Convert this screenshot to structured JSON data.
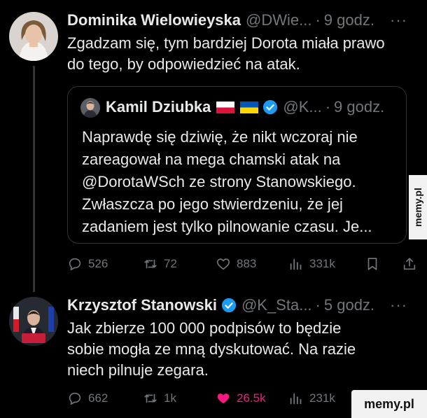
{
  "tweets": [
    {
      "name": "Dominika Wielowieyska",
      "handle": "@DWie...",
      "dot": "·",
      "time": "9 godz.",
      "more": "···",
      "lines": [
        "Zgadzam się, tym bardziej Dorota miała prawo",
        "do tego, by odpowiedzieć na atak."
      ],
      "quote": {
        "name": "Kamil Dziubka",
        "handle": "@K...",
        "dot": "·",
        "time": "9 godz.",
        "lines": [
          "Naprawdę się dziwię, że nikt wczoraj nie",
          "zareagował na mega chamski atak na",
          "@DorotaWSch ze strony Stanowskiego.",
          "Zwłaszcza po jego stwierdzeniu, że jej",
          "zadaniem jest tylko pilnowanie czasu. Je..."
        ]
      },
      "actions": {
        "replies": "526",
        "retweets": "72",
        "likes": "883",
        "views": "331k"
      }
    },
    {
      "name": "Krzysztof Stanowski",
      "handle": "@K_Sta...",
      "dot": "·",
      "time": "5 godz.",
      "more": "···",
      "lines": [
        "Jak zbierze 100 000 podpisów to będzie",
        "sobie mogła ze mną dyskutować. Na razie",
        "niech pilnuje zegara."
      ],
      "actions": {
        "replies": "662",
        "retweets": "1k",
        "likes": "26.5k",
        "views": "231k"
      }
    }
  ],
  "watermark": "memy.pl",
  "side_watermark": "memy.pl",
  "colors": {
    "background": "#000000",
    "text": "#e7e9ea",
    "muted": "#71767b",
    "verified": "#1d9bf0",
    "like": "#f91880"
  }
}
